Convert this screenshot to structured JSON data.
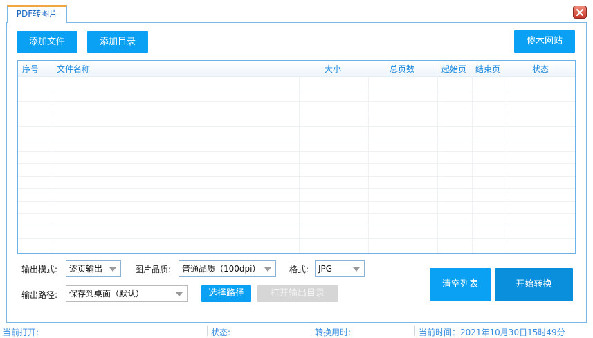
{
  "tab": {
    "label": "PDF转图片"
  },
  "toolbar": {
    "add_file": "添加文件",
    "add_dir": "添加目录",
    "site": "傻木网站"
  },
  "table": {
    "columns": [
      "序号",
      "文件名称",
      "大小",
      "总页数",
      "起始页",
      "结束页",
      "状态"
    ]
  },
  "options": {
    "mode_label": "输出模式:",
    "mode_value": "逐页输出",
    "quality_label": "图片品质:",
    "quality_value": "普通品质（100dpi）",
    "format_label": "格式:",
    "format_value": "JPG",
    "path_label": "输出路径:",
    "path_value": "保存到桌面（默认）",
    "choose_path": "选择路径",
    "open_output": "打开输出目录",
    "clear_list": "清空列表",
    "start": "开始转换"
  },
  "status": {
    "current_open": "当前打开:",
    "state": "状态:",
    "elapsed": "转换用时:",
    "time": "当前时间：2021年10月30日15时49分"
  },
  "colors": {
    "accent": "#0aa1f5",
    "border": "#7bb7e6",
    "tab_top": "#f2a640",
    "close": "#c7392a"
  }
}
